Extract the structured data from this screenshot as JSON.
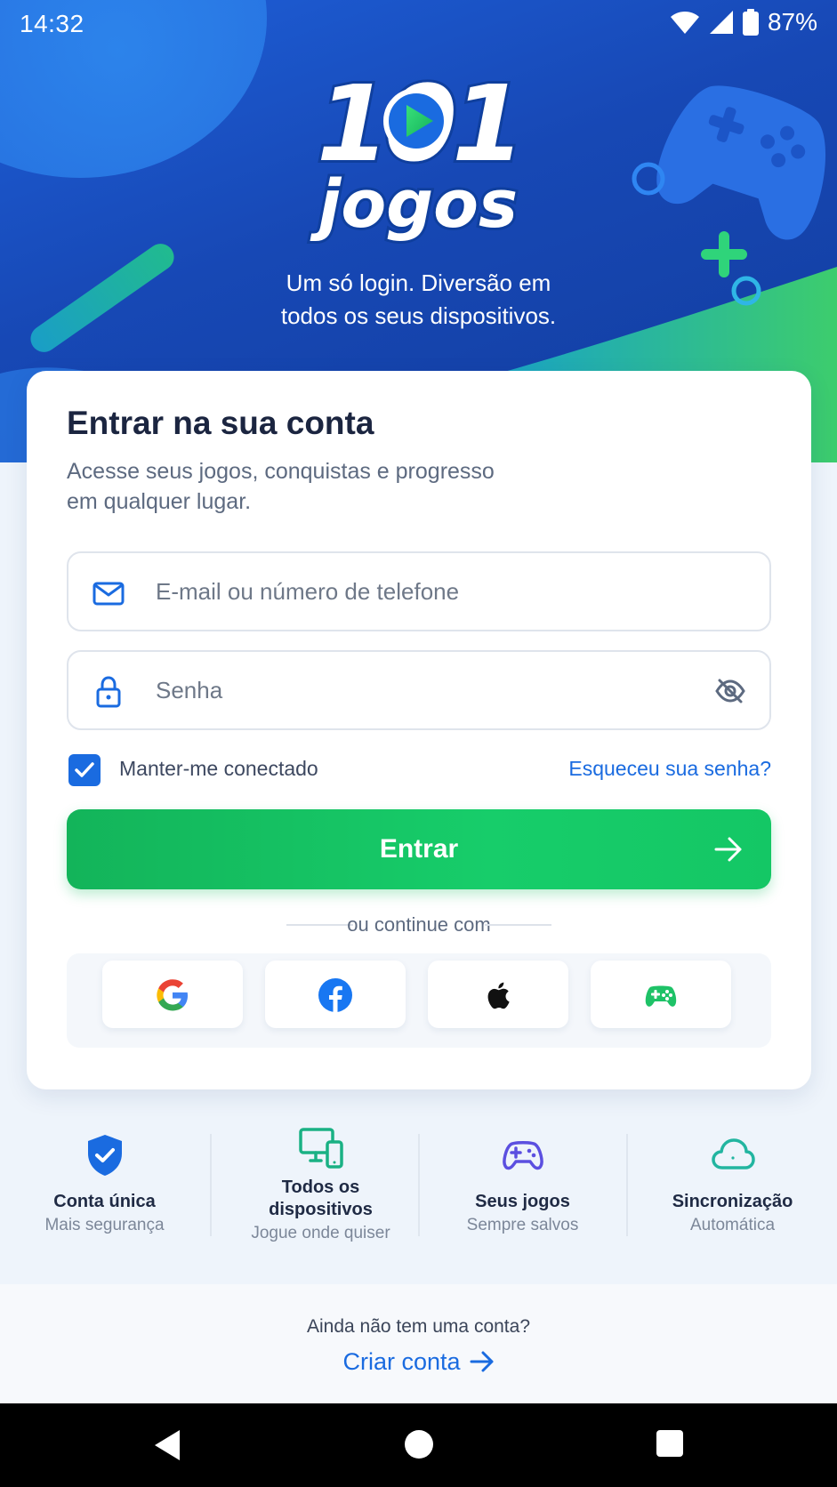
{
  "status_bar": {
    "time": "14:32",
    "battery": "87%",
    "icons": [
      "wifi-icon",
      "signal-icon",
      "battery-icon"
    ]
  },
  "hero": {
    "logo_number": "101",
    "logo_word": "jogos",
    "tagline_line1": "Um só login. Diversão em",
    "tagline_line2": "todos os seus dispositivos."
  },
  "login_card": {
    "title": "Entrar na sua conta",
    "subtitle_line1": "Acesse seus jogos, conquistas e progresso",
    "subtitle_line2": "em qualquer lugar.",
    "email_placeholder": "E-mail ou número de telefone",
    "password_placeholder": "Senha",
    "remember_label": "Manter-me conectado",
    "remember_checked": true,
    "forgot_label": "Esqueceu sua senha?",
    "submit_label": "Entrar",
    "divider_label": "ou continue com",
    "social_providers": [
      "google-icon",
      "facebook-icon",
      "apple-icon",
      "gamepad-icon"
    ]
  },
  "features": [
    {
      "icon": "shield-icon",
      "title": "Conta única",
      "desc": "Mais segurança"
    },
    {
      "icon": "devices-icon",
      "title_line1": "Todos os",
      "title_line2": "dispositivos",
      "desc": "Jogue onde quiser"
    },
    {
      "icon": "gamepad-icon",
      "title": "Seus jogos",
      "desc": "Sempre salvos"
    },
    {
      "icon": "cloud-icon",
      "title": "Sincronização",
      "desc": "Automática"
    }
  ],
  "signup": {
    "question": "Ainda não tem uma conta?",
    "create_label": "Criar conta"
  },
  "colors": {
    "primary_blue": "#1a6be0",
    "hero_blue": "#1748b5",
    "success_green": "#17c566",
    "text_dark": "#1b2540",
    "text_muted": "#5d6a80"
  }
}
